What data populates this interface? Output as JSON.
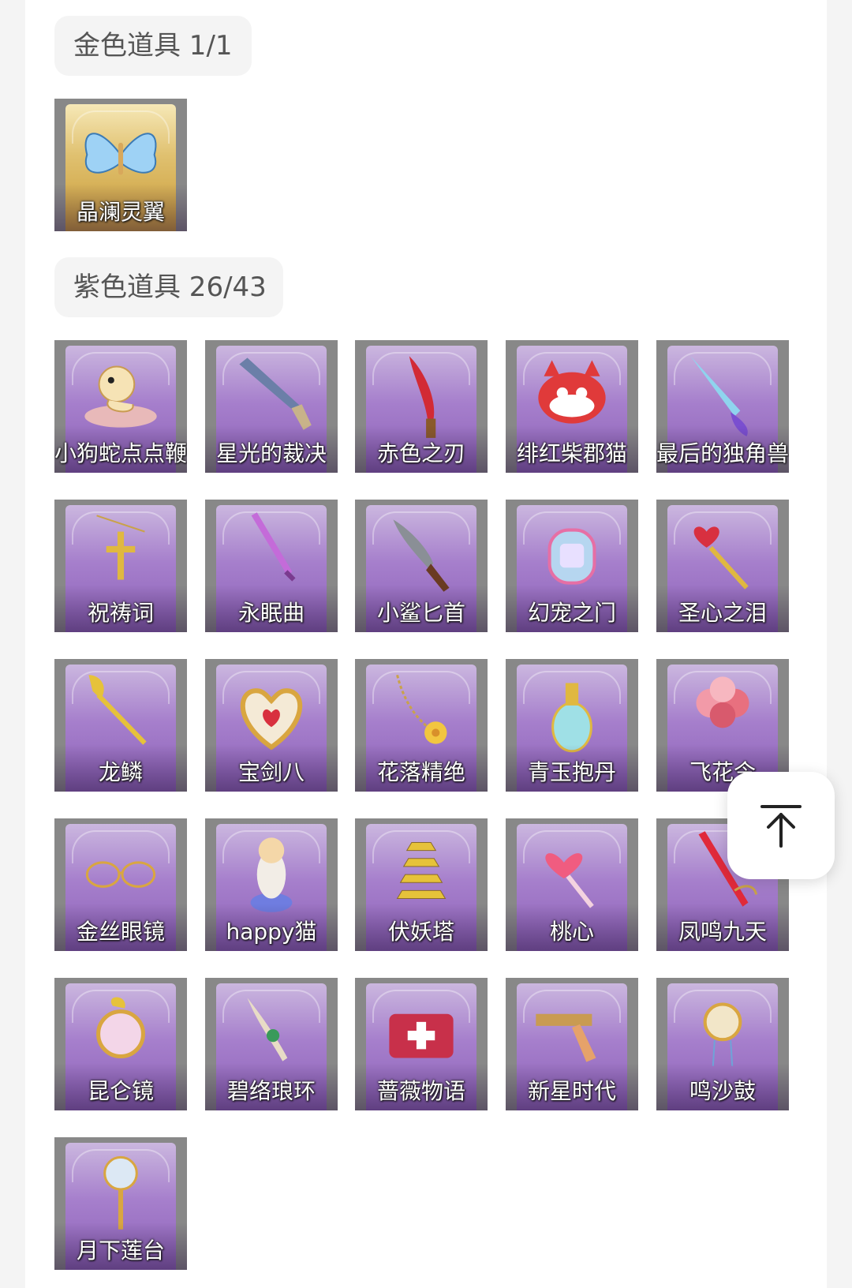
{
  "sections": [
    {
      "title": "金色道具 1/1",
      "items": [
        {
          "label": "晶澜灵翼",
          "icon": "butterfly-wings-icon"
        }
      ]
    },
    {
      "title": "紫色道具 26/43",
      "items": [
        {
          "label": "小狗蛇点点鞭",
          "icon": "snake-toy-icon"
        },
        {
          "label": "星光的裁决",
          "icon": "pistol-icon"
        },
        {
          "label": "赤色之刃",
          "icon": "red-blade-icon"
        },
        {
          "label": "绯红柴郡猫",
          "icon": "cheshire-cat-icon"
        },
        {
          "label": "最后的独角兽",
          "icon": "unicorn-horn-icon"
        },
        {
          "label": "祝祷词",
          "icon": "cross-pendant-icon"
        },
        {
          "label": "永眠曲",
          "icon": "sword-icon"
        },
        {
          "label": "小鲨匕首",
          "icon": "shark-dagger-icon"
        },
        {
          "label": "幻宠之门",
          "icon": "pet-device-icon"
        },
        {
          "label": "圣心之泪",
          "icon": "heart-scepter-icon"
        },
        {
          "label": "龙鳞",
          "icon": "golden-shovel-icon"
        },
        {
          "label": "宝剑八",
          "icon": "heart-locket-icon"
        },
        {
          "label": "花落精绝",
          "icon": "flower-chain-icon"
        },
        {
          "label": "青玉抱丹",
          "icon": "jade-vase-icon"
        },
        {
          "label": "飞花令",
          "icon": "flower-bouquet-icon"
        },
        {
          "label": "金丝眼镜",
          "icon": "glasses-icon"
        },
        {
          "label": "happy猫",
          "icon": "happy-cat-icon"
        },
        {
          "label": "伏妖塔",
          "icon": "pagoda-icon"
        },
        {
          "label": "桃心",
          "icon": "heart-wand-icon"
        },
        {
          "label": "凤鸣九天",
          "icon": "phoenix-blade-icon"
        },
        {
          "label": "昆仑镜",
          "icon": "mirror-icon"
        },
        {
          "label": "碧络琅环",
          "icon": "jade-blade-icon"
        },
        {
          "label": "蔷薇物语",
          "icon": "medkit-icon"
        },
        {
          "label": "新星时代",
          "icon": "revolver-icon"
        },
        {
          "label": "鸣沙鼓",
          "icon": "drum-charm-icon"
        },
        {
          "label": "月下莲台",
          "icon": "lotus-scepter-icon"
        }
      ]
    }
  ],
  "back_to_top": {
    "icon": "arrow-up-to-top-icon"
  },
  "colors": {
    "purple_card": "#a67fcc",
    "gold_card": "#e0c170",
    "tile_border": "#888888"
  }
}
